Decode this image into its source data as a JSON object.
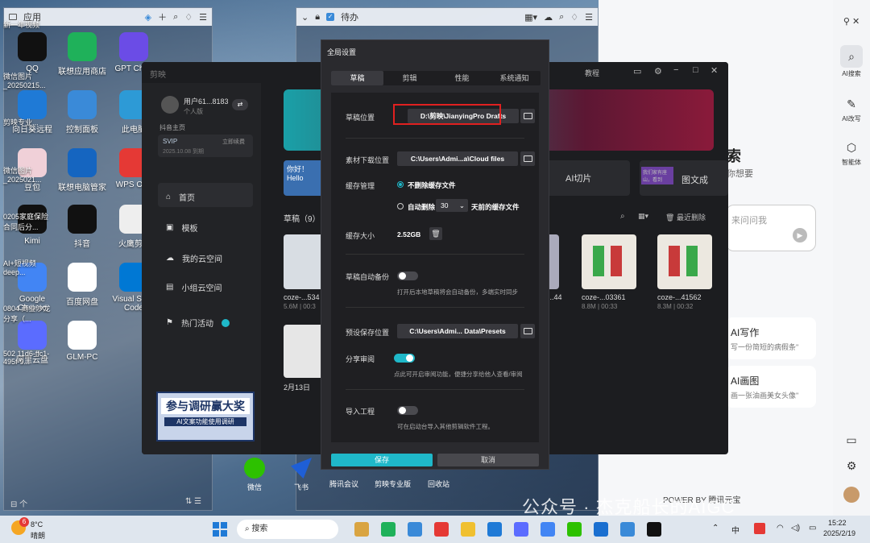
{
  "desktop": {
    "fence_left": {
      "title": "应用"
    },
    "fence_top": {
      "title": "待办"
    },
    "icons": [
      {
        "label": "QQ",
        "color": "#111"
      },
      {
        "label": "联想应用商店",
        "color": "#1fb15a"
      },
      {
        "label": "GPT Chr...",
        "color": "#6b4ce6"
      },
      {
        "label": "向日葵远程",
        "color": "#1f7ad6"
      },
      {
        "label": "控制面板",
        "color": "#3a8ad8"
      },
      {
        "label": "此电脑",
        "color": "#2d9ad6"
      },
      {
        "label": "豆包",
        "color": "#f0d0d8"
      },
      {
        "label": "联想电脑管家",
        "color": "#1565c0"
      },
      {
        "label": "WPS Of...",
        "color": "#e53935"
      },
      {
        "label": "Kimi",
        "color": "#111"
      },
      {
        "label": "抖音",
        "color": "#111"
      },
      {
        "label": "火鹰剪...",
        "color": "#eee"
      },
      {
        "label": "Google Chrome",
        "color": "#4285f4"
      },
      {
        "label": "百度网盘",
        "color": "#fff"
      },
      {
        "label": "Visual Stu... Code",
        "color": "#0078d4"
      },
      {
        "label": "阿里云盘",
        "color": "#5b6cff"
      },
      {
        "label": "GLM-PC",
        "color": "#fff"
      }
    ],
    "stray_texts": [
      "新一年视频",
      "微信图片_20250215...",
      "剪映专业...",
      "微信图片_2025021...",
      "0205家庭保险合同后分...",
      "AI+短视频deep...",
      "0804 商业沙龙分享（...",
      "502 11d6-ffc1-495f-9..."
    ],
    "badges": {
      "lenovo_store": "6",
      "douyin": "10"
    },
    "bottom_fence": [
      "微信",
      "飞书",
      "腾讯会议",
      "剪映专业版",
      "回收站"
    ],
    "watermark": "公众号 · 杰克船长的AIGC",
    "power_by": "POWER BY 腾讯元宝"
  },
  "right_sidebar": {
    "items": [
      "AI搜索",
      "AI改写",
      "智能体"
    ]
  },
  "yuanbao": {
    "heading": "索",
    "sub": "你想要",
    "input_placeholder": "来问问我",
    "cards": [
      {
        "title": "AI写作",
        "desc": "写一份简短的病假条\""
      },
      {
        "title": "AI画图",
        "desc": "画一张油画美女头像\""
      }
    ]
  },
  "jianying": {
    "title": "剪映",
    "tutorial": "教程",
    "user": "用户61...8183",
    "user_sub": "个人版",
    "douyin_home": "抖音主页",
    "svip": "SVIP",
    "svip_action": "立即续费",
    "svip_date": "2025.10.08 到期",
    "nav": [
      "首页",
      "模板",
      "我的云空间",
      "小组云空间",
      "热门活动"
    ],
    "drafts_title": "草稿（9）",
    "recent_delete": "最近删除",
    "ai_cut": "AI切片",
    "graphic": "图文成",
    "dream_card": "我们家有座山，看到",
    "hello_card": "你好！Hello",
    "drafts": [
      {
        "name": "coze-...534",
        "meta": "5.6M | 00:3"
      },
      {
        "name": "coze-...03361",
        "meta": "8.8M | 00:33"
      },
      {
        "name": "coze-...41562",
        "meta": "8.3M | 00:32"
      },
      {
        "name": "...44",
        "meta": "00:33"
      }
    ],
    "draft_date": {
      "name": "2月13日",
      "meta": "..."
    },
    "promo_title": "参与调研赢大奖",
    "promo_sub": "AI文案功能使用调研"
  },
  "settings": {
    "title": "全局设置",
    "tabs": [
      "草稿",
      "剪辑",
      "性能",
      "系统通知"
    ],
    "draft_location": {
      "label": "草稿位置",
      "value": "D:\\剪映\\JianyingPro Drafts"
    },
    "material_download": {
      "label": "素材下载位置",
      "value": "C:\\Users\\Admi...a\\Cloud files"
    },
    "cache": {
      "label": "缓存管理",
      "opt1": "不删除缓存文件",
      "opt2_pre": "自动删除",
      "days": "30",
      "opt2_post": "天前的缓存文件"
    },
    "cache_size": {
      "label": "缓存大小",
      "value": "2.52GB"
    },
    "auto_backup": {
      "label": "草稿自动备份",
      "hint": "打开后本地草稿将会自动备份，多端实时同步",
      "on": false
    },
    "preset_location": {
      "label": "预设保存位置",
      "value": "C:\\Users\\Admi... Data\\Presets"
    },
    "share_review": {
      "label": "分享审阅",
      "hint": "点此可开启审阅功能，便捷分享给他人查看/审阅",
      "on": true
    },
    "import_project": {
      "label": "导入工程",
      "hint": "可在启动台导入其他剪辑软件工程。",
      "on": false
    },
    "save": "保存",
    "cancel": "取消",
    "accent": "#1fb8c9",
    "highlight": "#e02020"
  },
  "taskbar": {
    "weather_temp": "8°C",
    "weather_desc": "晴朗",
    "weather_badge": "6",
    "search": "搜索",
    "ime": "中",
    "time": "15:22",
    "date": "2025/2/19"
  }
}
